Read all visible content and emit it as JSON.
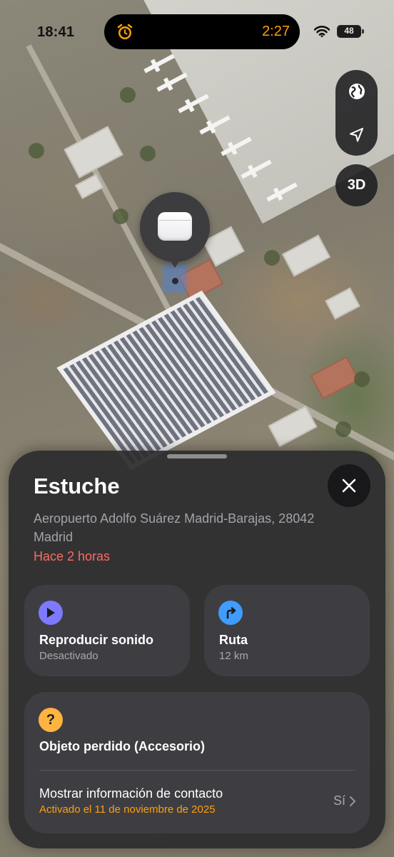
{
  "status_bar": {
    "time": "18:41",
    "timer": "2:27",
    "battery": "48"
  },
  "map_controls": {
    "globe_icon": "globe-icon",
    "location_icon": "location-arrow-icon",
    "view_3d_label": "3D"
  },
  "item": {
    "name": "Estuche",
    "address": "Aeropuerto Adolfo Suárez Madrid-Barajas, 28042 Madrid",
    "last_seen": "Hace 2 horas"
  },
  "actions": {
    "play_sound": {
      "title": "Reproducir sonido",
      "subtitle": "Desactivado",
      "icon": "play-icon",
      "color": "#7d7aff"
    },
    "directions": {
      "title": "Ruta",
      "subtitle": "12 km",
      "icon": "turn-right-arrow-icon",
      "color": "#409cff"
    }
  },
  "lost_mode": {
    "title": "Objeto perdido (Accesorio)",
    "icon": "question-mark-icon",
    "icon_color": "#ffb340",
    "contact_label": "Mostrar información de contacto",
    "contact_status": "Activado el 11 de noviembre de 2025",
    "contact_value": "Sí"
  },
  "colors": {
    "accent_red": "#ff6961",
    "accent_orange": "#ff9f0a",
    "sheet_bg": "#2c2c2e"
  }
}
